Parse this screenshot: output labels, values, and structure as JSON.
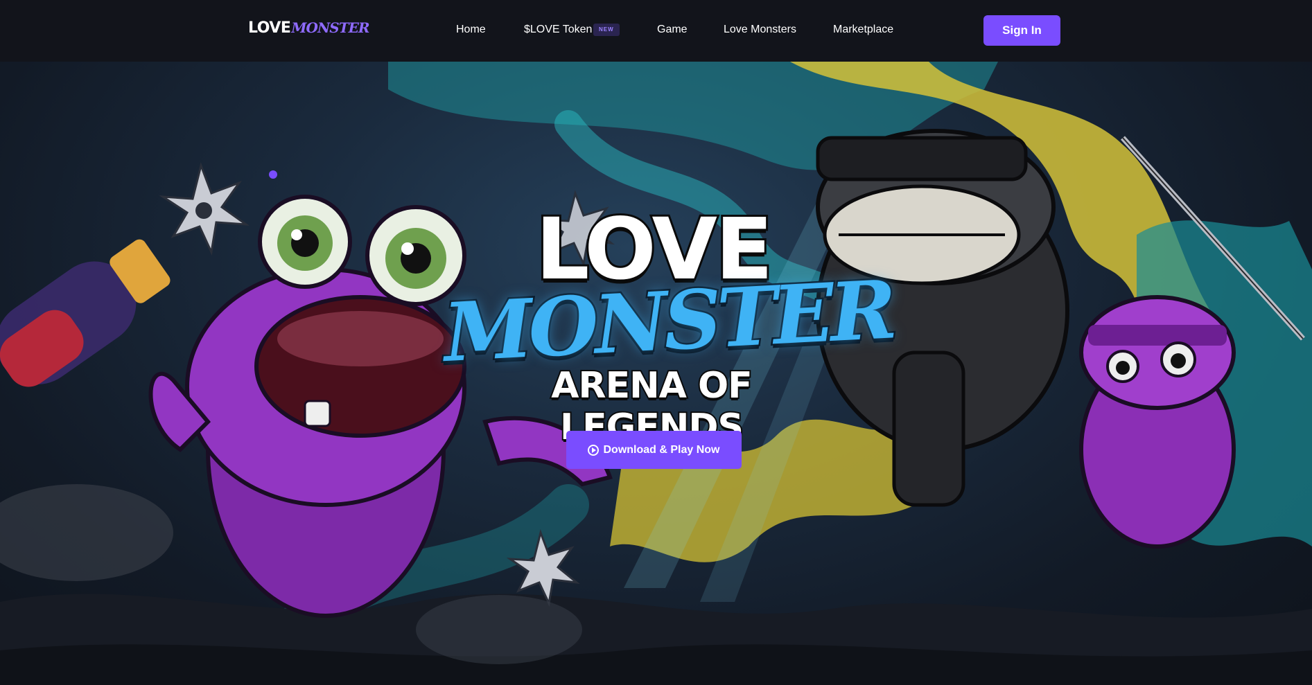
{
  "brand": {
    "logo_love": "LOVE",
    "logo_monster": "MONSTER"
  },
  "nav": {
    "items": [
      {
        "label": "Home"
      },
      {
        "label": "$LOVE Token",
        "badge": "NEW"
      },
      {
        "label": "Game"
      },
      {
        "label": "Love Monsters"
      },
      {
        "label": "Marketplace"
      }
    ],
    "signin_label": "Sign In"
  },
  "hero": {
    "title_line1": "LOVE",
    "title_line2": "MONSTER",
    "title_line3": "ARENA OF LEGENDS",
    "cta_label": "Download & Play Now",
    "cta_icon": "play-circle-icon"
  },
  "colors": {
    "accent": "#7a4dff",
    "title_blue": "#3fb3f5",
    "monster_purple": "#8b2fb5",
    "background": "#12141b"
  }
}
